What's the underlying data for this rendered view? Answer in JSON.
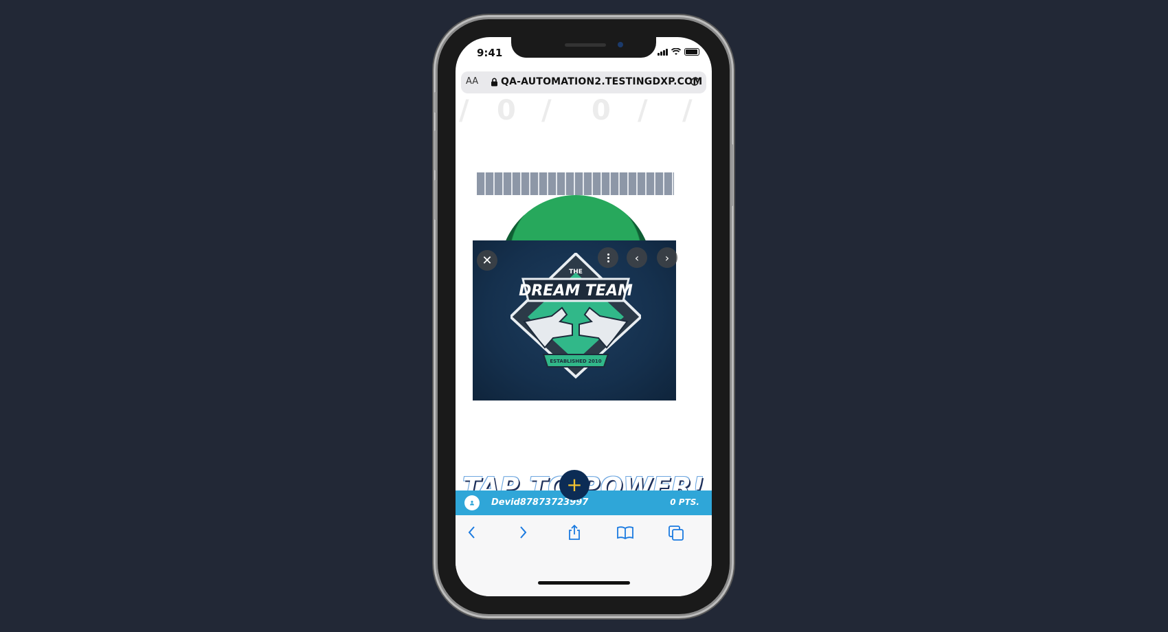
{
  "status_bar": {
    "time": "9:41",
    "icons": [
      "signal-icon",
      "wifi-icon",
      "battery-icon"
    ]
  },
  "browser": {
    "text_size_label": "AA",
    "url": "QA-AUTOMATION2.TESTINGDXP.COM",
    "icons": [
      "lock-icon",
      "reload-icon"
    ]
  },
  "page": {
    "title": "██████████████████████",
    "modal": {
      "image_logo": {
        "top_text": "THE",
        "main_text": "DREAM TEAM",
        "ribbon_text": "ESTABLISHED 2010"
      },
      "icons": [
        "close-icon",
        "more-options-icon",
        "previous-icon",
        "next-icon"
      ]
    },
    "tap_text": "TAP TO POWER!",
    "fab_label": "+"
  },
  "user_bar": {
    "username": "Devid87873723997",
    "points": "0 PTS."
  },
  "toolbar": {
    "icons": [
      "back-icon",
      "forward-icon",
      "share-icon",
      "bookmarks-icon",
      "tabs-icon"
    ]
  },
  "colors": {
    "background": "#222836",
    "user_bar": "#2fa6d8",
    "fab": "#0c2c55",
    "fab_plus": "#f2c230",
    "accent_blue": "#1a7ae0"
  }
}
